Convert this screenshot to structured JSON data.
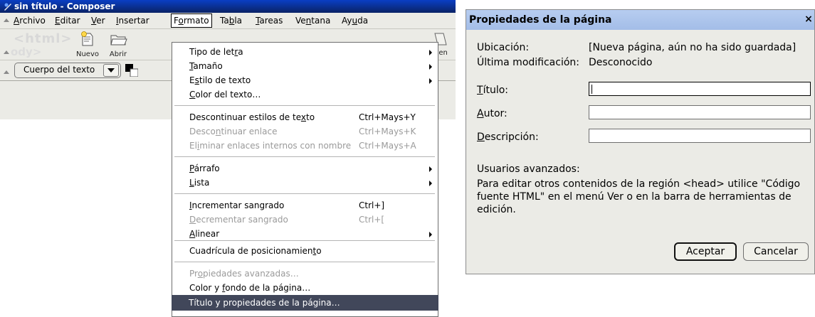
{
  "window": {
    "title": "sin título - Composer"
  },
  "menubar": {
    "items": [
      {
        "pre": "",
        "ul": "A",
        "post": "rchivo"
      },
      {
        "pre": "",
        "ul": "E",
        "post": "ditar"
      },
      {
        "pre": "",
        "ul": "V",
        "post": "er"
      },
      {
        "pre": "",
        "ul": "I",
        "post": "nsertar"
      },
      {
        "pre": "F",
        "ul": "o",
        "post": "rmato"
      },
      {
        "pre": "Ta",
        "ul": "b",
        "post": "la"
      },
      {
        "pre": "",
        "ul": "T",
        "post": "areas"
      },
      {
        "pre": "Ve",
        "ul": "n",
        "post": "tana"
      },
      {
        "pre": "Ay",
        "ul": "u",
        "post": "da"
      }
    ]
  },
  "toolbar": {
    "logo_text": "<html>",
    "logo_sub": "ody>",
    "nuevo": "Nuevo",
    "abrir": "Abrir",
    "partial_label": "nen"
  },
  "formatbar": {
    "paragraph_value": "Cuerpo del texto"
  },
  "format_menu": {
    "items": [
      {
        "pre": "Tipo de let",
        "ul": "r",
        "post": "a",
        "shortcut": "",
        "submenu": true,
        "disabled": false
      },
      {
        "pre": "",
        "ul": "T",
        "post": "amaño",
        "shortcut": "",
        "submenu": true,
        "disabled": false
      },
      {
        "pre": "E",
        "ul": "s",
        "post": "tilo de texto",
        "shortcut": "",
        "submenu": true,
        "disabled": false
      },
      {
        "pre": "",
        "ul": "C",
        "post": "olor del texto…",
        "shortcut": "",
        "submenu": false,
        "disabled": false
      },
      {
        "pre": "Descontinuar estilos de te",
        "ul": "x",
        "post": "to",
        "shortcut": "Ctrl+Mays+Y",
        "submenu": false,
        "disabled": false
      },
      {
        "pre": "Desco",
        "ul": "n",
        "post": "tinuar enlace",
        "shortcut": "Ctrl+Mays+K",
        "submenu": false,
        "disabled": true
      },
      {
        "pre": "El",
        "ul": "i",
        "post": "minar enlaces internos con nombre",
        "shortcut": "Ctrl+Mays+A",
        "submenu": false,
        "disabled": true
      },
      {
        "pre": "",
        "ul": "P",
        "post": "árrafo",
        "shortcut": "",
        "submenu": true,
        "disabled": false
      },
      {
        "pre": "",
        "ul": "L",
        "post": "ista",
        "shortcut": "",
        "submenu": true,
        "disabled": false
      },
      {
        "pre": "",
        "ul": "I",
        "post": "ncrementar sangrado",
        "shortcut": "Ctrl+]",
        "submenu": false,
        "disabled": false
      },
      {
        "pre": "",
        "ul": "D",
        "post": "ecrementar sangrado",
        "shortcut": "Ctrl+[",
        "submenu": false,
        "disabled": true
      },
      {
        "pre": "",
        "ul": "A",
        "post": "linear",
        "shortcut": "",
        "submenu": true,
        "disabled": false
      },
      {
        "pre": "Cuadrícula de posicionamien",
        "ul": "t",
        "post": "o",
        "shortcut": "",
        "submenu": false,
        "disabled": false
      },
      {
        "pre": "Pr",
        "ul": "o",
        "post": "piedades avanzadas…",
        "shortcut": "",
        "submenu": false,
        "disabled": true
      },
      {
        "pre": "Color y ",
        "ul": "f",
        "post": "ondo de la página…",
        "shortcut": "",
        "submenu": false,
        "disabled": false
      },
      {
        "pre": "Título y propiedades de la página…",
        "ul": "",
        "post": "",
        "shortcut": "",
        "submenu": false,
        "disabled": false,
        "selected": true
      }
    ]
  },
  "dialog": {
    "title": "Propiedades de la página",
    "close": "×",
    "ubicacion_label": "Ubicación:",
    "ubicacion_value": "[Nueva página, aún no ha sido guardada]",
    "modificacion_label": "Última modificación:",
    "modificacion_value": "Desconocido",
    "titulo": {
      "ul": "T",
      "post": "ítulo:",
      "value": ""
    },
    "autor": {
      "ul": "A",
      "post": "utor:",
      "value": ""
    },
    "descripcion": {
      "ul": "D",
      "post": "escripción:",
      "value": ""
    },
    "advanced_heading": "Usuarios avanzados:",
    "advanced_text": "Para editar otros contenidos de la región <head> utilice \"Código fuente HTML\" en el menú Ver o en la barra de herramientas de edición.",
    "ok_label": "Aceptar",
    "cancel_label": "Cancelar"
  },
  "colors": {
    "title_bar": "#0a246a",
    "menu_selection": "#41475a",
    "dialog_title": "#a3bde8",
    "chrome": "#ebebe6"
  }
}
